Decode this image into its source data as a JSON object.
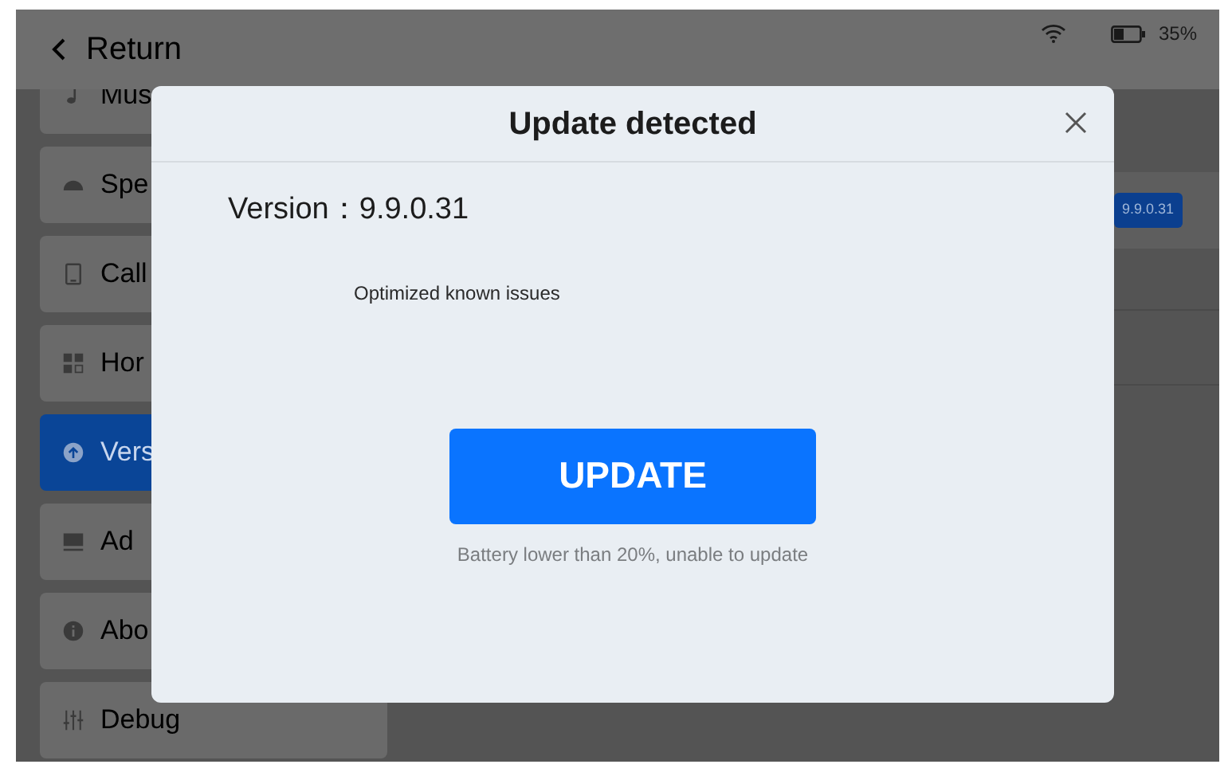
{
  "status_bar": {
    "battery_text": "35%"
  },
  "header": {
    "back_label": "Return"
  },
  "sidebar": {
    "items": [
      {
        "label": "Mus",
        "selected": false
      },
      {
        "label": "Spe",
        "selected": false
      },
      {
        "label": "Call",
        "selected": false
      },
      {
        "label": "Hor",
        "selected": false
      },
      {
        "label": "Vers",
        "selected": true
      },
      {
        "label": "Ad",
        "selected": false
      },
      {
        "label": "Abo",
        "selected": false
      },
      {
        "label": "Debug",
        "selected": false
      }
    ]
  },
  "content": {
    "version_badge": "9.9.0.31"
  },
  "dialog": {
    "title": "Update detected",
    "version_label": "Version：",
    "version": "9.9.0.31",
    "notes": "Optimized known issues",
    "button": "UPDATE",
    "warning": "Battery lower than 20%, unable to update"
  }
}
